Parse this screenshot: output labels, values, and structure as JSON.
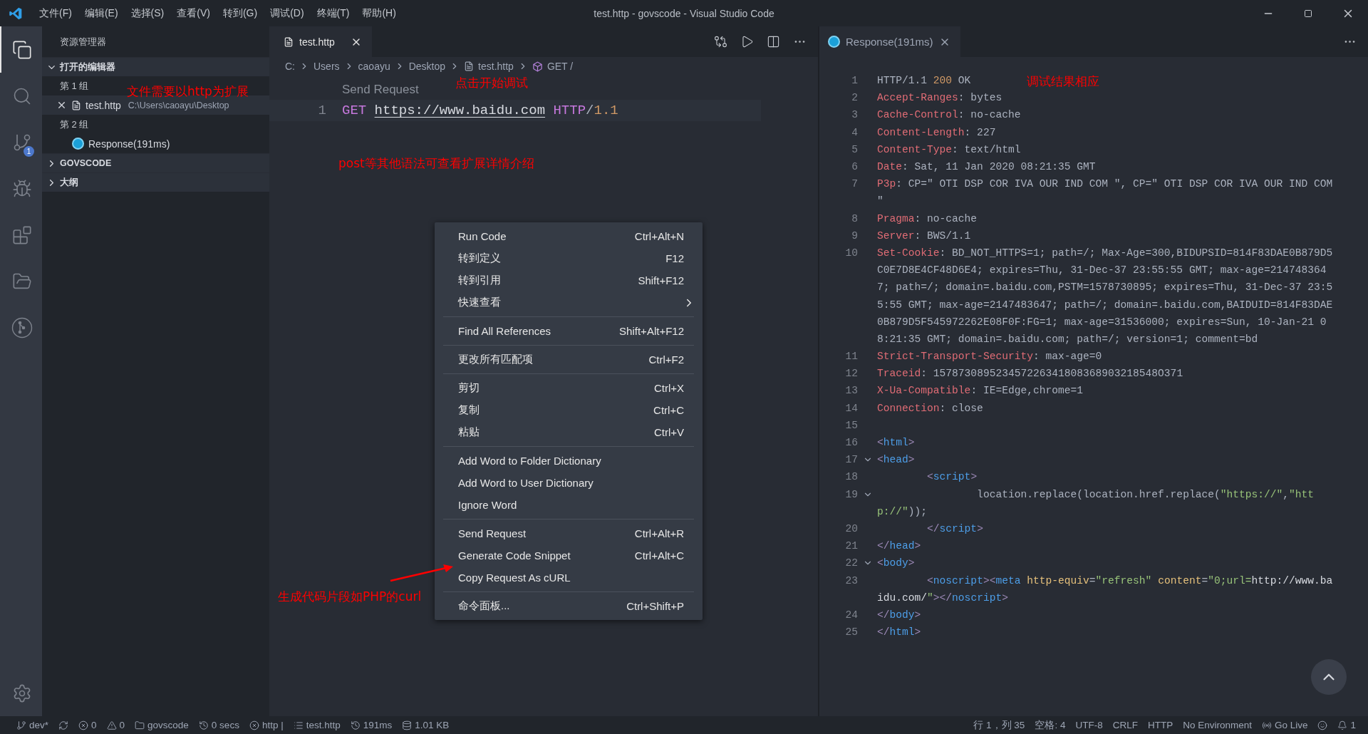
{
  "window": {
    "title": "test.http - govscode - Visual Studio Code"
  },
  "menu_bar": [
    "文件(F)",
    "编辑(E)",
    "选择(S)",
    "查看(V)",
    "转到(G)",
    "调试(D)",
    "终端(T)",
    "帮助(H)"
  ],
  "activity_bar": [
    {
      "kind": "explorer",
      "selected": true
    },
    {
      "kind": "search",
      "selected": false
    },
    {
      "kind": "scm",
      "selected": false,
      "badge": "1"
    },
    {
      "kind": "debug",
      "selected": false
    },
    {
      "kind": "extensions",
      "selected": false
    },
    {
      "kind": "folders",
      "selected": false
    },
    {
      "kind": "remote",
      "selected": false
    },
    {
      "kind": "settings",
      "selected": false
    }
  ],
  "sidebar": {
    "title": "资源管理器",
    "annotation": "文件需要以http为扩展",
    "sections": [
      {
        "label": "打开的编辑器",
        "expanded": true,
        "groups": [
          {
            "label": "第 1 组",
            "items": [
              {
                "kind": "file",
                "name": "test.http",
                "path": "C:\\Users\\caoayu\\Desktop",
                "selected": true
              }
            ]
          },
          {
            "label": "第 2 组",
            "items": [
              {
                "kind": "response",
                "name": "Response(191ms)",
                "selected": false
              }
            ]
          }
        ]
      },
      {
        "label": "GOVSCODE",
        "expanded": false
      },
      {
        "label": "大纲",
        "expanded": false
      }
    ]
  },
  "editor": {
    "tab": {
      "label": "test.http"
    },
    "breadcrumb": [
      {
        "kind": "folder",
        "text": "C:"
      },
      {
        "kind": "folder",
        "text": "Users"
      },
      {
        "kind": "folder",
        "text": "caoayu"
      },
      {
        "kind": "folder",
        "text": "Desktop"
      },
      {
        "kind": "file",
        "text": "test.http"
      },
      {
        "kind": "symbol",
        "text": "GET /"
      }
    ],
    "codelens": "Send Request",
    "lines": [
      {
        "num": "1",
        "tokens": [
          {
            "kind": "method",
            "text": "GET "
          },
          {
            "kind": "url",
            "text": "https://www.baidu.com"
          },
          {
            "kind": "keyword",
            "text": " HTTP"
          },
          {
            "kind": "plain",
            "text": "/"
          },
          {
            "kind": "number",
            "text": "1.1"
          }
        ]
      }
    ],
    "annotations": [
      {
        "kind": "codelens",
        "text": "点击开始调试"
      },
      {
        "kind": "note",
        "text": "post等其他语法可查看扩展详情介绍"
      },
      {
        "kind": "arrow",
        "text": "生成代码片段如PHP的curl"
      }
    ],
    "context_menu": [
      [
        {
          "label": "Run Code",
          "shortcut": "Ctrl+Alt+N"
        },
        {
          "label": "转到定义",
          "shortcut": "F12"
        },
        {
          "label": "转到引用",
          "shortcut": "Shift+F12"
        },
        {
          "label": "快速查看",
          "submenu": true
        }
      ],
      [
        {
          "label": "Find All References",
          "shortcut": "Shift+Alt+F12"
        }
      ],
      [
        {
          "label": "更改所有匹配项",
          "shortcut": "Ctrl+F2"
        }
      ],
      [
        {
          "label": "剪切",
          "shortcut": "Ctrl+X"
        },
        {
          "label": "复制",
          "shortcut": "Ctrl+C"
        },
        {
          "label": "粘贴",
          "shortcut": "Ctrl+V"
        }
      ],
      [
        {
          "label": "Add Word to Folder Dictionary"
        },
        {
          "label": "Add Word to User Dictionary"
        },
        {
          "label": "Ignore Word"
        }
      ],
      [
        {
          "label": "Send Request",
          "shortcut": "Ctrl+Alt+R"
        },
        {
          "label": "Generate Code Snippet",
          "shortcut": "Ctrl+Alt+C"
        },
        {
          "label": "Copy Request As cURL"
        }
      ],
      [
        {
          "label": "命令面板...",
          "shortcut": "Ctrl+Shift+P"
        }
      ]
    ]
  },
  "response": {
    "tab": {
      "label": "Response(191ms)"
    },
    "annotation": "调试结果相应",
    "rows": [
      {
        "num": "1",
        "tokens": [
          {
            "kind": "plain",
            "text": "HTTP/1.1 "
          },
          {
            "kind": "status",
            "text": "200"
          },
          {
            "kind": "plain",
            "text": " OK"
          }
        ]
      },
      {
        "num": "2",
        "tokens": [
          {
            "kind": "key",
            "text": "Accept-Ranges"
          },
          {
            "kind": "plain",
            "text": ": bytes"
          }
        ]
      },
      {
        "num": "3",
        "tokens": [
          {
            "kind": "key",
            "text": "Cache-Control"
          },
          {
            "kind": "plain",
            "text": ": no-cache"
          }
        ]
      },
      {
        "num": "4",
        "tokens": [
          {
            "kind": "key",
            "text": "Content-Length"
          },
          {
            "kind": "plain",
            "text": ": 227"
          }
        ]
      },
      {
        "num": "5",
        "tokens": [
          {
            "kind": "key",
            "text": "Content-Type"
          },
          {
            "kind": "plain",
            "text": ": text/html"
          }
        ]
      },
      {
        "num": "6",
        "tokens": [
          {
            "kind": "key",
            "text": "Date"
          },
          {
            "kind": "plain",
            "text": ": Sat, 11 Jan 2020 08:21:35 GMT"
          }
        ]
      },
      {
        "num": "7",
        "tokens": [
          {
            "kind": "key",
            "text": "P3p"
          },
          {
            "kind": "plain",
            "text": ": CP=\" OTI DSP COR IVA OUR IND COM \", CP=\" OTI DSP COR IVA OUR IND COM"
          }
        ]
      },
      {
        "tokens": [
          {
            "kind": "plain",
            "text": "\""
          }
        ]
      },
      {
        "num": "8",
        "tokens": [
          {
            "kind": "key",
            "text": "Pragma"
          },
          {
            "kind": "plain",
            "text": ": no-cache"
          }
        ]
      },
      {
        "num": "9",
        "tokens": [
          {
            "kind": "key",
            "text": "Server"
          },
          {
            "kind": "plain",
            "text": ": BWS/1.1"
          }
        ]
      },
      {
        "num": "10",
        "tokens": [
          {
            "kind": "key",
            "text": "Set-Cookie"
          },
          {
            "kind": "plain",
            "text": ": BD_NOT_HTTPS=1; path=/; Max-Age=300,BIDUPSID=814F83DAE0B879D5"
          }
        ]
      },
      {
        "tokens": [
          {
            "kind": "plain",
            "text": "C0E7D8E4CF48D6E4; expires=Thu, 31-Dec-37 23:55:55 GMT; max-age=214748364"
          }
        ]
      },
      {
        "tokens": [
          {
            "kind": "plain",
            "text": "7; path=/; domain=.baidu.com,PSTM=1578730895; expires=Thu, 31-Dec-37 23:5"
          }
        ]
      },
      {
        "tokens": [
          {
            "kind": "plain",
            "text": "5:55 GMT; max-age=2147483647; path=/; domain=.baidu.com,BAIDUID=814F83DAE"
          }
        ]
      },
      {
        "tokens": [
          {
            "kind": "plain",
            "text": "0B879D5F545972262E08F0F:FG=1; max-age=31536000; expires=Sun, 10-Jan-21 0"
          }
        ]
      },
      {
        "tokens": [
          {
            "kind": "plain",
            "text": "8:21:35 GMT; domain=.baidu.com; path=/; version=1; comment=bd"
          }
        ]
      },
      {
        "num": "11",
        "tokens": [
          {
            "kind": "key",
            "text": "Strict-Transport-Security"
          },
          {
            "kind": "plain",
            "text": ": max-age=0"
          }
        ]
      },
      {
        "num": "12",
        "tokens": [
          {
            "kind": "key",
            "text": "Traceid"
          },
          {
            "kind": "plain",
            "text": ": 157873089523457226341808368903218548O371"
          }
        ]
      },
      {
        "num": "13",
        "tokens": [
          {
            "kind": "key",
            "text": "X-Ua-Compatible"
          },
          {
            "kind": "plain",
            "text": ": IE=Edge,chrome=1"
          }
        ]
      },
      {
        "num": "14",
        "tokens": [
          {
            "kind": "key",
            "text": "Connection"
          },
          {
            "kind": "plain",
            "text": ": close"
          }
        ]
      },
      {
        "num": "15",
        "tokens": []
      },
      {
        "num": "16",
        "tokens": [
          {
            "kind": "bracket",
            "text": "<"
          },
          {
            "kind": "tag",
            "text": "html"
          },
          {
            "kind": "bracket",
            "text": ">"
          }
        ]
      },
      {
        "num": "17",
        "fold": true,
        "tokens": [
          {
            "kind": "bracket",
            "text": "<"
          },
          {
            "kind": "tag",
            "text": "head"
          },
          {
            "kind": "bracket",
            "text": ">"
          }
        ]
      },
      {
        "num": "18",
        "tokens": [
          {
            "kind": "bracket",
            "text": "        <"
          },
          {
            "kind": "tag",
            "text": "script"
          },
          {
            "kind": "bracket",
            "text": ">"
          }
        ]
      },
      {
        "num": "19",
        "fold": true,
        "tokens": [
          {
            "kind": "plain",
            "text": "                location.replace(location.href.replace("
          },
          {
            "kind": "string",
            "text": "\"https://\""
          },
          {
            "kind": "plain",
            "text": ","
          },
          {
            "kind": "string",
            "text": "\"htt"
          }
        ]
      },
      {
        "tokens": [
          {
            "kind": "string",
            "text": "p://\""
          },
          {
            "kind": "plain",
            "text": "));"
          }
        ]
      },
      {
        "num": "20",
        "tokens": [
          {
            "kind": "bracket",
            "text": "        </"
          },
          {
            "kind": "tag",
            "text": "script"
          },
          {
            "kind": "bracket",
            "text": ">"
          }
        ]
      },
      {
        "num": "21",
        "tokens": [
          {
            "kind": "bracket",
            "text": "</"
          },
          {
            "kind": "tag",
            "text": "head"
          },
          {
            "kind": "bracket",
            "text": ">"
          }
        ]
      },
      {
        "num": "22",
        "fold": true,
        "tokens": [
          {
            "kind": "bracket",
            "text": "<"
          },
          {
            "kind": "tag",
            "text": "body"
          },
          {
            "kind": "bracket",
            "text": ">"
          }
        ]
      },
      {
        "num": "23",
        "tokens": [
          {
            "kind": "bracket",
            "text": "        <"
          },
          {
            "kind": "tag",
            "text": "noscript"
          },
          {
            "kind": "bracket",
            "text": "><"
          },
          {
            "kind": "tag",
            "text": "meta"
          },
          {
            "kind": "attr",
            "text": " http-equiv"
          },
          {
            "kind": "plain",
            "text": "="
          },
          {
            "kind": "string",
            "text": "\"refresh\""
          },
          {
            "kind": "attr",
            "text": " content"
          },
          {
            "kind": "plain",
            "text": "="
          },
          {
            "kind": "string",
            "text": "\"0;url="
          },
          {
            "kind": "url",
            "text": "http://www.ba"
          }
        ]
      },
      {
        "tokens": [
          {
            "kind": "url",
            "text": "idu.com/"
          },
          {
            "kind": "string",
            "text": "\""
          },
          {
            "kind": "bracket",
            "text": "></"
          },
          {
            "kind": "tag",
            "text": "noscript"
          },
          {
            "kind": "bracket",
            "text": ">"
          }
        ]
      },
      {
        "num": "24",
        "tokens": [
          {
            "kind": "bracket",
            "text": "</"
          },
          {
            "kind": "tag",
            "text": "body"
          },
          {
            "kind": "bracket",
            "text": ">"
          }
        ]
      },
      {
        "num": "25",
        "tokens": [
          {
            "kind": "bracket",
            "text": "</"
          },
          {
            "kind": "tag",
            "text": "html"
          },
          {
            "kind": "bracket",
            "text": ">"
          }
        ]
      }
    ]
  },
  "status_bar": {
    "left": [
      {
        "kind": "branch",
        "text": "dev*"
      },
      {
        "kind": "sync"
      },
      {
        "kind": "errors",
        "text": "0"
      },
      {
        "kind": "warnings",
        "text": "0"
      },
      {
        "kind": "folder",
        "text": "govscode"
      },
      {
        "kind": "history",
        "text": "0 secs"
      },
      {
        "kind": "cancel",
        "text": "http |"
      },
      {
        "kind": "list",
        "text": "test.http"
      },
      {
        "kind": "history",
        "text": "191ms"
      },
      {
        "kind": "size",
        "text": "1.01 KB"
      }
    ],
    "right": [
      {
        "kind": "text",
        "text": "行 1，列 35"
      },
      {
        "kind": "text",
        "text": "空格: 4"
      },
      {
        "kind": "text",
        "text": "UTF-8"
      },
      {
        "kind": "text",
        "text": "CRLF"
      },
      {
        "kind": "text",
        "text": "HTTP"
      },
      {
        "kind": "text",
        "text": "No Environment"
      },
      {
        "kind": "live",
        "text": "Go Live"
      },
      {
        "kind": "feedback"
      },
      {
        "kind": "bell",
        "text": "1"
      }
    ]
  }
}
